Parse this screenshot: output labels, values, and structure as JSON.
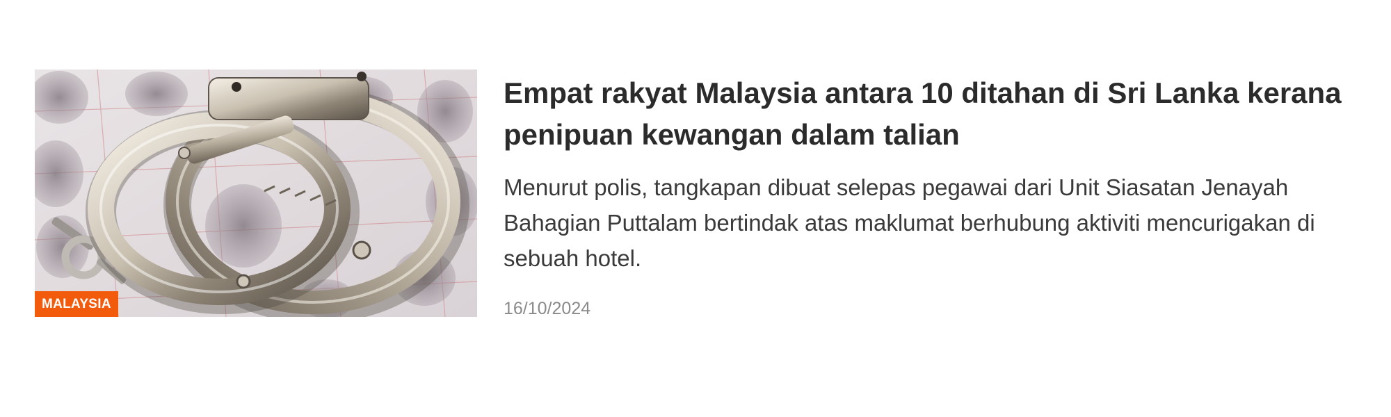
{
  "article": {
    "category": "MALAYSIA",
    "headline": "Empat rakyat Malaysia antara 10 ditahan di Sri Lanka kerana penipuan kewangan dalam talian",
    "summary": "Menurut polis, tangkapan dibuat selepas pegawai dari Unit Siasatan Jenayah Bahagian Puttalam bertindak atas maklumat berhubung aktiviti mencurigakan di sebuah hotel.",
    "date": "16/10/2024",
    "thumbnail_icon": "handcuffs-image",
    "badge_color": "#f25a0c"
  }
}
